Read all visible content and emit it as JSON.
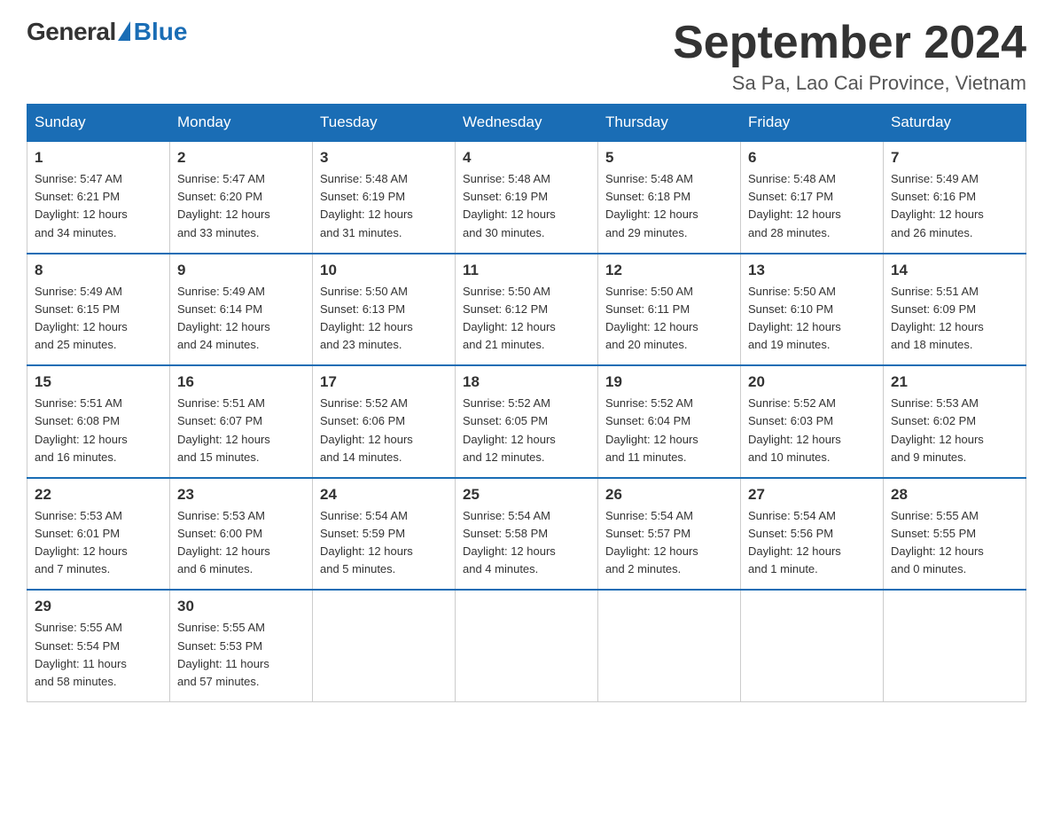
{
  "logo": {
    "general": "General",
    "blue": "Blue"
  },
  "title": "September 2024",
  "location": "Sa Pa, Lao Cai Province, Vietnam",
  "days_of_week": [
    "Sunday",
    "Monday",
    "Tuesday",
    "Wednesday",
    "Thursday",
    "Friday",
    "Saturday"
  ],
  "weeks": [
    [
      {
        "day": 1,
        "sunrise": "5:47 AM",
        "sunset": "6:21 PM",
        "daylight": "12 hours and 34 minutes."
      },
      {
        "day": 2,
        "sunrise": "5:47 AM",
        "sunset": "6:20 PM",
        "daylight": "12 hours and 33 minutes."
      },
      {
        "day": 3,
        "sunrise": "5:48 AM",
        "sunset": "6:19 PM",
        "daylight": "12 hours and 31 minutes."
      },
      {
        "day": 4,
        "sunrise": "5:48 AM",
        "sunset": "6:19 PM",
        "daylight": "12 hours and 30 minutes."
      },
      {
        "day": 5,
        "sunrise": "5:48 AM",
        "sunset": "6:18 PM",
        "daylight": "12 hours and 29 minutes."
      },
      {
        "day": 6,
        "sunrise": "5:48 AM",
        "sunset": "6:17 PM",
        "daylight": "12 hours and 28 minutes."
      },
      {
        "day": 7,
        "sunrise": "5:49 AM",
        "sunset": "6:16 PM",
        "daylight": "12 hours and 26 minutes."
      }
    ],
    [
      {
        "day": 8,
        "sunrise": "5:49 AM",
        "sunset": "6:15 PM",
        "daylight": "12 hours and 25 minutes."
      },
      {
        "day": 9,
        "sunrise": "5:49 AM",
        "sunset": "6:14 PM",
        "daylight": "12 hours and 24 minutes."
      },
      {
        "day": 10,
        "sunrise": "5:50 AM",
        "sunset": "6:13 PM",
        "daylight": "12 hours and 23 minutes."
      },
      {
        "day": 11,
        "sunrise": "5:50 AM",
        "sunset": "6:12 PM",
        "daylight": "12 hours and 21 minutes."
      },
      {
        "day": 12,
        "sunrise": "5:50 AM",
        "sunset": "6:11 PM",
        "daylight": "12 hours and 20 minutes."
      },
      {
        "day": 13,
        "sunrise": "5:50 AM",
        "sunset": "6:10 PM",
        "daylight": "12 hours and 19 minutes."
      },
      {
        "day": 14,
        "sunrise": "5:51 AM",
        "sunset": "6:09 PM",
        "daylight": "12 hours and 18 minutes."
      }
    ],
    [
      {
        "day": 15,
        "sunrise": "5:51 AM",
        "sunset": "6:08 PM",
        "daylight": "12 hours and 16 minutes."
      },
      {
        "day": 16,
        "sunrise": "5:51 AM",
        "sunset": "6:07 PM",
        "daylight": "12 hours and 15 minutes."
      },
      {
        "day": 17,
        "sunrise": "5:52 AM",
        "sunset": "6:06 PM",
        "daylight": "12 hours and 14 minutes."
      },
      {
        "day": 18,
        "sunrise": "5:52 AM",
        "sunset": "6:05 PM",
        "daylight": "12 hours and 12 minutes."
      },
      {
        "day": 19,
        "sunrise": "5:52 AM",
        "sunset": "6:04 PM",
        "daylight": "12 hours and 11 minutes."
      },
      {
        "day": 20,
        "sunrise": "5:52 AM",
        "sunset": "6:03 PM",
        "daylight": "12 hours and 10 minutes."
      },
      {
        "day": 21,
        "sunrise": "5:53 AM",
        "sunset": "6:02 PM",
        "daylight": "12 hours and 9 minutes."
      }
    ],
    [
      {
        "day": 22,
        "sunrise": "5:53 AM",
        "sunset": "6:01 PM",
        "daylight": "12 hours and 7 minutes."
      },
      {
        "day": 23,
        "sunrise": "5:53 AM",
        "sunset": "6:00 PM",
        "daylight": "12 hours and 6 minutes."
      },
      {
        "day": 24,
        "sunrise": "5:54 AM",
        "sunset": "5:59 PM",
        "daylight": "12 hours and 5 minutes."
      },
      {
        "day": 25,
        "sunrise": "5:54 AM",
        "sunset": "5:58 PM",
        "daylight": "12 hours and 4 minutes."
      },
      {
        "day": 26,
        "sunrise": "5:54 AM",
        "sunset": "5:57 PM",
        "daylight": "12 hours and 2 minutes."
      },
      {
        "day": 27,
        "sunrise": "5:54 AM",
        "sunset": "5:56 PM",
        "daylight": "12 hours and 1 minute."
      },
      {
        "day": 28,
        "sunrise": "5:55 AM",
        "sunset": "5:55 PM",
        "daylight": "12 hours and 0 minutes."
      }
    ],
    [
      {
        "day": 29,
        "sunrise": "5:55 AM",
        "sunset": "5:54 PM",
        "daylight": "11 hours and 58 minutes."
      },
      {
        "day": 30,
        "sunrise": "5:55 AM",
        "sunset": "5:53 PM",
        "daylight": "11 hours and 57 minutes."
      },
      null,
      null,
      null,
      null,
      null
    ]
  ]
}
